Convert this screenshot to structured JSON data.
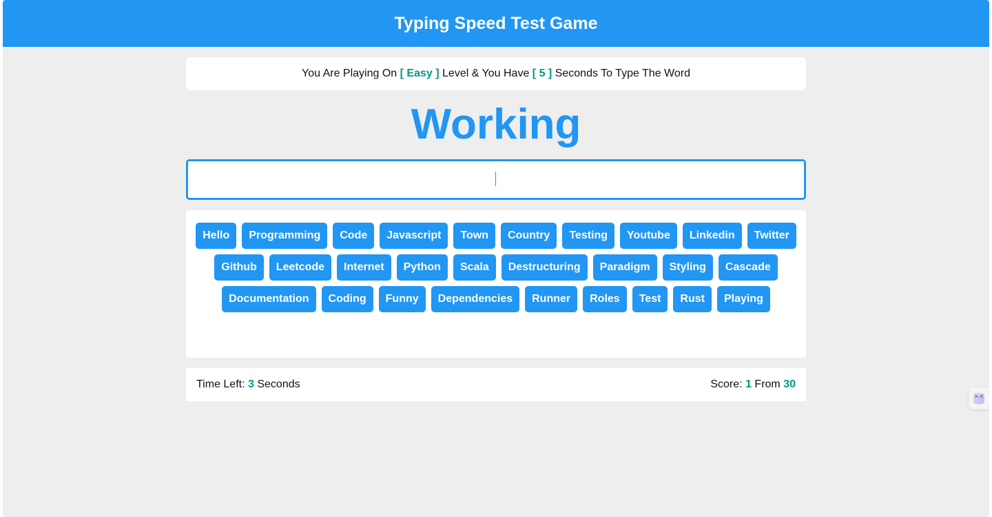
{
  "header": {
    "title": "Typing Speed Test Game"
  },
  "message": {
    "prefix": "You Are Playing On",
    "level": "[ Easy ]",
    "middle": "Level & You Have",
    "seconds": "[ 5 ]",
    "suffix": "Seconds To Type The Word"
  },
  "current_word": "Working",
  "input": {
    "value": "",
    "placeholder": ""
  },
  "upcoming_words": [
    "Hello",
    "Programming",
    "Code",
    "Javascript",
    "Town",
    "Country",
    "Testing",
    "Youtube",
    "Linkedin",
    "Twitter",
    "Github",
    "Leetcode",
    "Internet",
    "Python",
    "Scala",
    "Destructuring",
    "Paradigm",
    "Styling",
    "Cascade",
    "Documentation",
    "Coding",
    "Funny",
    "Dependencies",
    "Runner",
    "Roles",
    "Test",
    "Rust",
    "Playing"
  ],
  "control": {
    "time_label": "Time Left:",
    "time_value": "3",
    "time_unit": "Seconds",
    "score_label": "Score:",
    "score_value": "1",
    "score_from_label": "From",
    "score_total": "30"
  },
  "colors": {
    "primary": "#2196f3",
    "accent": "#009688",
    "background": "#eeeeee"
  },
  "side_tab": {
    "icon": "assistant-face-icon"
  }
}
